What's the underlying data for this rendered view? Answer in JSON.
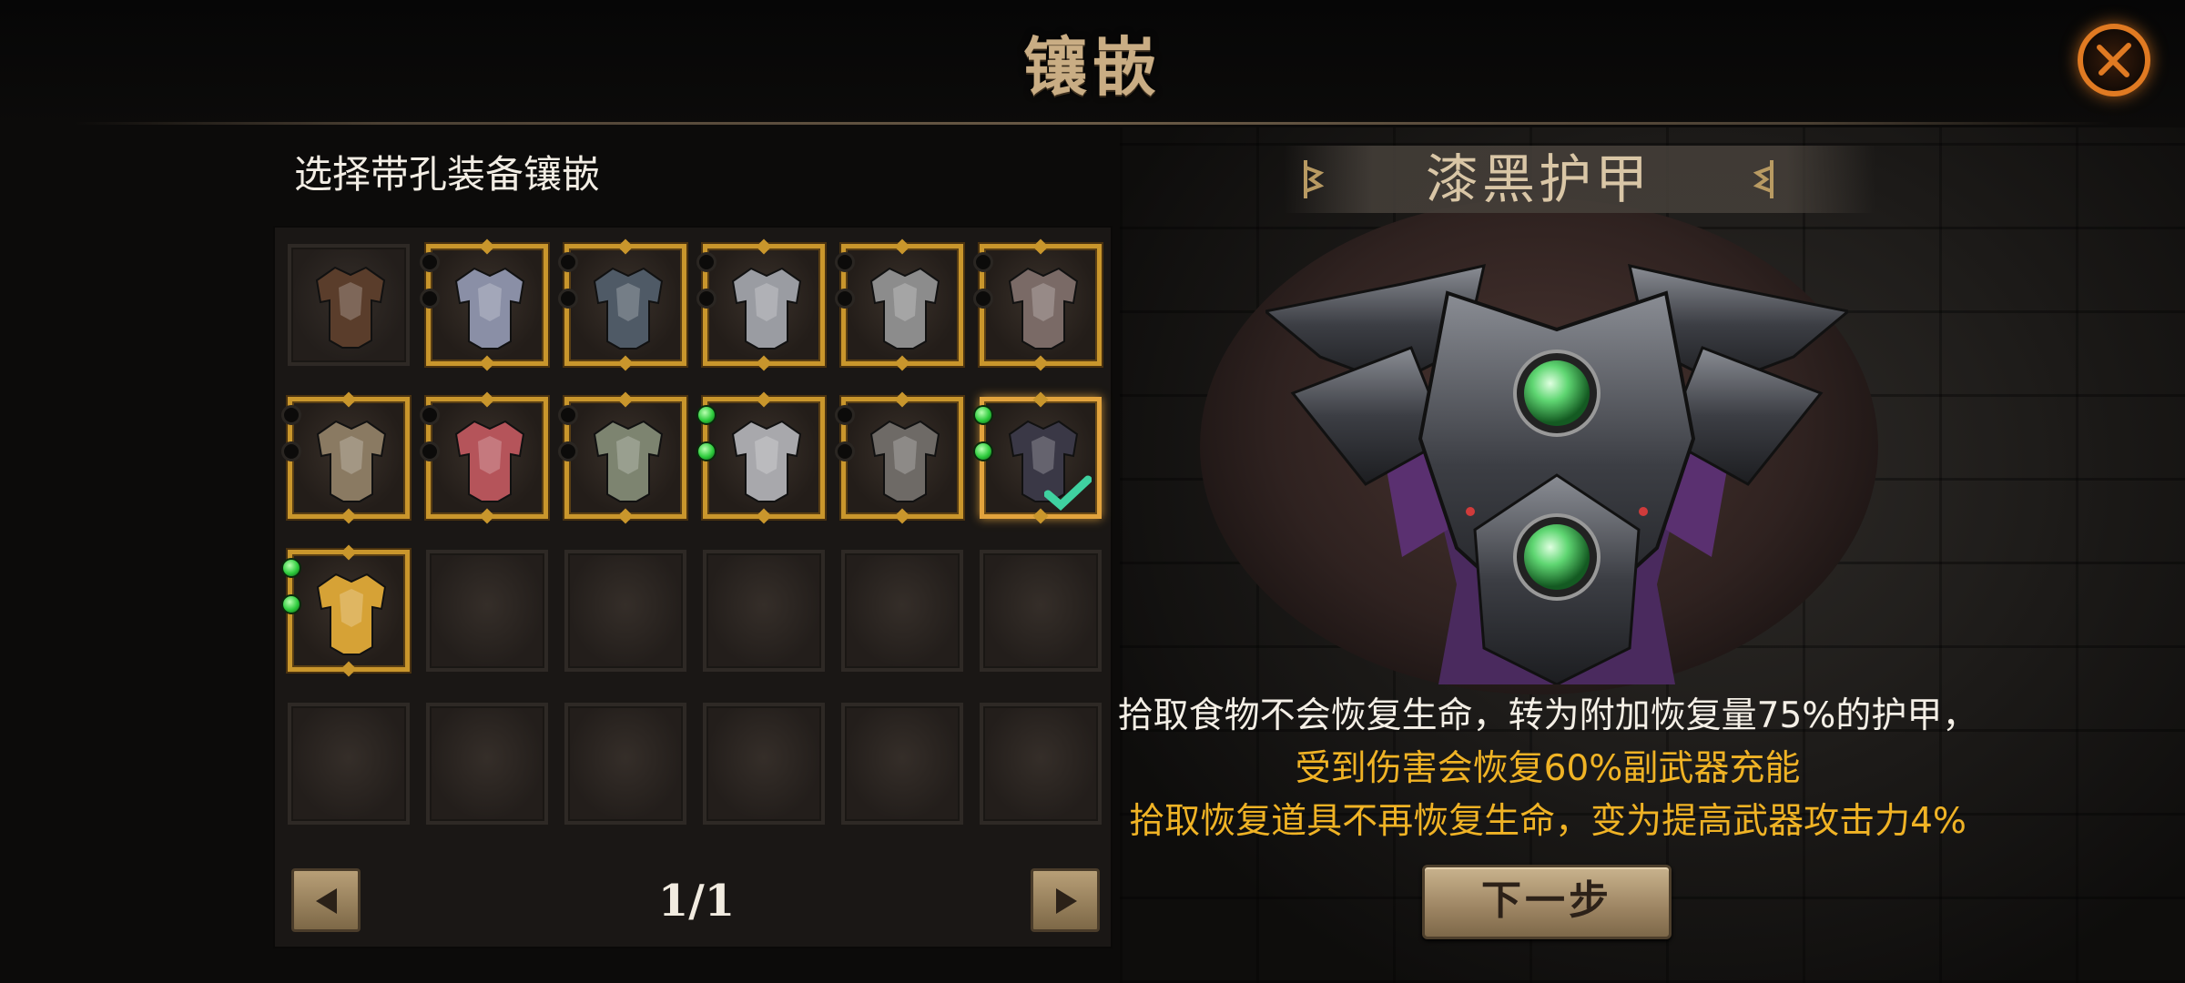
{
  "header": {
    "title": "镶嵌",
    "close_icon": "close-x-icon"
  },
  "inventory": {
    "prompt": "选择带孔装备镶嵌",
    "page_indicator": "1/1",
    "prev_icon": "triangle-left-icon",
    "next_icon": "triangle-right-icon",
    "slots": [
      {
        "state": "plain",
        "armor": "#5a3d2b",
        "sockets": []
      },
      {
        "state": "gold",
        "armor": "#8a8fa6",
        "sockets": [
          "empty",
          "empty"
        ]
      },
      {
        "state": "gold",
        "armor": "#4f5a66",
        "sockets": [
          "empty",
          "empty"
        ]
      },
      {
        "state": "gold",
        "armor": "#9a9ca2",
        "sockets": [
          "empty",
          "empty"
        ]
      },
      {
        "state": "gold",
        "armor": "#8c8c8c",
        "sockets": [
          "empty",
          "empty"
        ]
      },
      {
        "state": "gold",
        "armor": "#7a6a66",
        "sockets": [
          "empty",
          "empty"
        ]
      },
      {
        "state": "gold",
        "armor": "#8a7a62",
        "sockets": [
          "empty",
          "empty"
        ]
      },
      {
        "state": "gold",
        "armor": "#b5545a",
        "sockets": [
          "empty",
          "empty"
        ]
      },
      {
        "state": "gold",
        "armor": "#7d8470",
        "sockets": [
          "empty",
          "empty"
        ]
      },
      {
        "state": "gold",
        "armor": "#a8a8ac",
        "sockets": [
          "green",
          "green"
        ]
      },
      {
        "state": "gold",
        "armor": "#6e6a66",
        "sockets": [
          "empty",
          "empty"
        ]
      },
      {
        "state": "selected",
        "armor": "#3a3846",
        "sockets": [
          "green",
          "green"
        ],
        "checked": true
      },
      {
        "state": "gold",
        "armor": "#d6a236",
        "sockets": [
          "green",
          "green"
        ]
      },
      {
        "state": "empty",
        "armor": null,
        "sockets": []
      },
      {
        "state": "empty",
        "armor": null,
        "sockets": []
      },
      {
        "state": "empty",
        "armor": null,
        "sockets": []
      },
      {
        "state": "empty",
        "armor": null,
        "sockets": []
      },
      {
        "state": "empty",
        "armor": null,
        "sockets": []
      },
      {
        "state": "empty",
        "armor": null,
        "sockets": []
      },
      {
        "state": "empty",
        "armor": null,
        "sockets": []
      },
      {
        "state": "empty",
        "armor": null,
        "sockets": []
      },
      {
        "state": "empty",
        "armor": null,
        "sockets": []
      },
      {
        "state": "empty",
        "armor": null,
        "sockets": []
      },
      {
        "state": "empty",
        "armor": null,
        "sockets": []
      }
    ]
  },
  "detail": {
    "item_name": "漆黑护甲",
    "effects": [
      "拾取食物不会恢复生命，转为附加恢复量75%的护甲，",
      "受到伤害会恢复60%副武器充能",
      "拾取恢复道具不再恢复生命，变为提高武器攻击力4%"
    ],
    "next_button": "下一步"
  },
  "colors": {
    "accent_gold": "#c9962c",
    "effect_yellow": "#f0b325",
    "title": "#c9ad84",
    "close_orange": "#e07a22"
  }
}
